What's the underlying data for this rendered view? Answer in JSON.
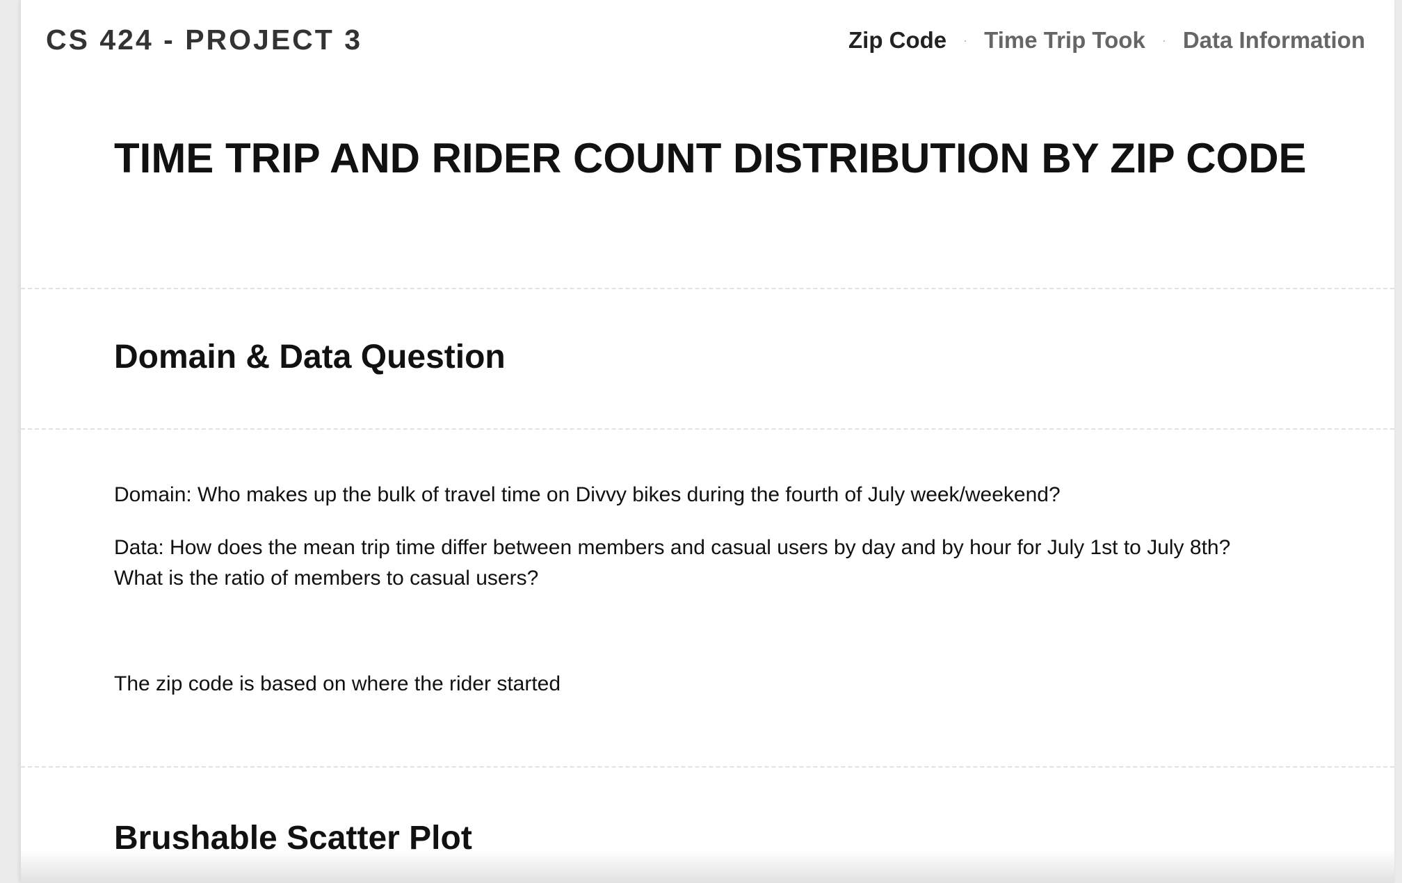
{
  "header": {
    "site_title": "CS 424 - PROJECT 3",
    "nav": [
      {
        "label": "Zip Code",
        "active": true
      },
      {
        "label": "Time Trip Took",
        "active": false
      },
      {
        "label": "Data Information",
        "active": false
      }
    ],
    "separator": "·"
  },
  "page": {
    "title": "TIME TRIP AND RIDER COUNT DISTRIBUTION BY ZIP CODE"
  },
  "domain_section": {
    "heading": "Domain & Data Question"
  },
  "questions": {
    "domain": "Domain: Who makes up the bulk of travel time on Divvy bikes during the fourth of July week/weekend?",
    "data_line1": "Data: How does the mean trip time differ between members and casual users by day and by hour for July 1st to July 8th?",
    "data_line2": "What is the ratio of members to casual users?",
    "note": "The zip code is based on where the rider started"
  },
  "scatter_section": {
    "heading": "Brushable Scatter Plot"
  },
  "colors": {
    "background": "#ececec",
    "page": "#ffffff",
    "text": "#111111",
    "nav_text": "#666666",
    "divider": "#e2e2e2"
  }
}
